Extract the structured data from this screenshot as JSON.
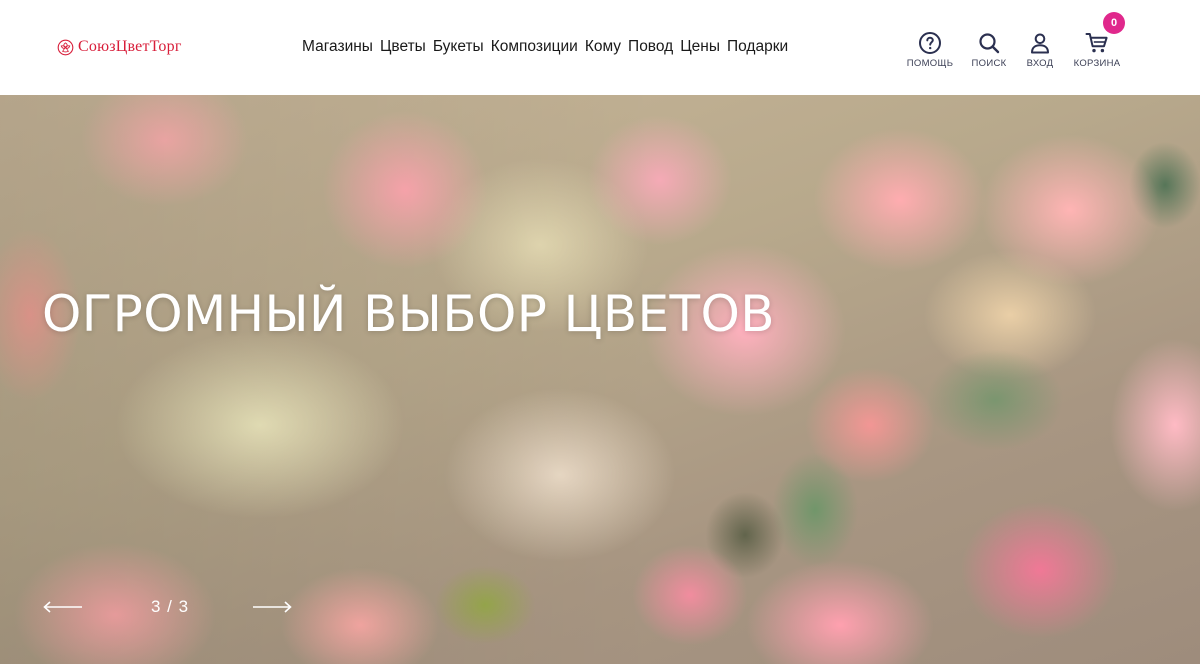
{
  "brand": {
    "name": "СоюзЦветТорг",
    "color": "#d81e3a"
  },
  "nav": {
    "items": [
      {
        "label": "Магазины"
      },
      {
        "label": "Цветы"
      },
      {
        "label": "Букеты"
      },
      {
        "label": "Композиции"
      },
      {
        "label": "Кому"
      },
      {
        "label": "Повод"
      },
      {
        "label": "Цены"
      },
      {
        "label": "Подарки"
      }
    ]
  },
  "tools": {
    "help": {
      "label": "ПОМОЩЬ",
      "icon": "question-circle-icon"
    },
    "search": {
      "label": "ПОИСК",
      "icon": "search-icon"
    },
    "login": {
      "label": "ВХОД",
      "icon": "user-icon"
    },
    "cart": {
      "label": "КОРЗИНА",
      "icon": "cart-icon",
      "count": "0",
      "badge_color": "#e0288c"
    }
  },
  "hero": {
    "title": "ОГРОМНЫЙ ВЫБОР ЦВЕТОВ",
    "counter": "3 / 3",
    "prev_icon": "arrow-left-icon",
    "next_icon": "arrow-right-icon"
  }
}
